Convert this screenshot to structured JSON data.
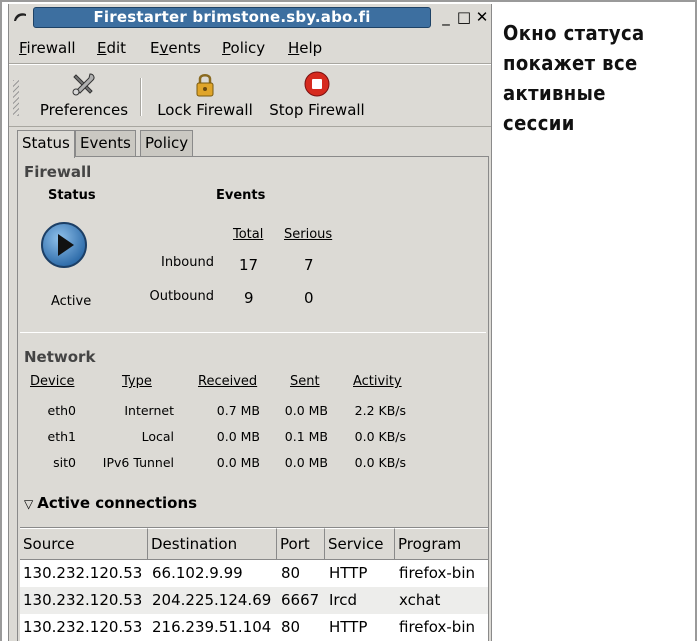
{
  "window": {
    "title": "Firestarter brimstone.sby.abo.fi",
    "controls": {
      "minimize": "_",
      "maximize": "□",
      "close": "✕"
    }
  },
  "menubar": {
    "items": [
      {
        "label": "Firewall",
        "mnemonic": "F",
        "rest": "irewall"
      },
      {
        "label": "Edit",
        "mnemonic": "E",
        "rest": "dit"
      },
      {
        "label": "Events",
        "mnemonic": "v",
        "pre": "E",
        "rest": "ents"
      },
      {
        "label": "Policy",
        "mnemonic": "P",
        "rest": "olicy"
      },
      {
        "label": "Help",
        "mnemonic": "H",
        "rest": "elp"
      }
    ]
  },
  "toolbar": {
    "preferences": {
      "label": "Preferences",
      "icon": "tools-icon"
    },
    "lock": {
      "label": "Lock Firewall",
      "icon": "padlock-icon"
    },
    "stop": {
      "label": "Stop Firewall",
      "icon": "stop-icon"
    }
  },
  "tabs": [
    {
      "label": "Status",
      "active": true
    },
    {
      "label": "Events",
      "active": false
    },
    {
      "label": "Policy",
      "active": false
    }
  ],
  "firewall": {
    "section_title": "Firewall",
    "status_header": "Status",
    "events_header": "Events",
    "total_header": "Total",
    "serious_header": "Serious",
    "status_text": "Active",
    "status_icon": "play-icon",
    "rows": [
      {
        "label": "Inbound",
        "total": "17",
        "serious": "7"
      },
      {
        "label": "Outbound",
        "total": "9",
        "serious": "0"
      }
    ]
  },
  "network": {
    "section_title": "Network",
    "headers": {
      "device": "Device",
      "type": "Type",
      "received": "Received",
      "sent": "Sent",
      "activity": "Activity"
    },
    "rows": [
      {
        "device": "eth0",
        "type": "Internet",
        "received": "0.7 MB",
        "sent": "0.0 MB",
        "activity": "2.2 KB/s"
      },
      {
        "device": "eth1",
        "type": "Local",
        "received": "0.0 MB",
        "sent": "0.1 MB",
        "activity": "0.0 KB/s"
      },
      {
        "device": "sit0",
        "type": "IPv6 Tunnel",
        "received": "0.0 MB",
        "sent": "0.0 MB",
        "activity": "0.0 KB/s"
      }
    ]
  },
  "connections": {
    "section_title": "Active connections",
    "expander": "▽",
    "headers": {
      "source": "Source",
      "destination": "Destination",
      "port": "Port",
      "service": "Service",
      "program": "Program"
    },
    "rows": [
      {
        "source": "130.232.120.53",
        "destination": "66.102.9.99",
        "port": "80",
        "service": "HTTP",
        "program": "firefox-bin"
      },
      {
        "source": "130.232.120.53",
        "destination": "204.225.124.69",
        "port": "6667",
        "service": "Ircd",
        "program": "xchat"
      },
      {
        "source": "130.232.120.53",
        "destination": "216.239.51.104",
        "port": "80",
        "service": "HTTP",
        "program": "firefox-bin"
      }
    ]
  },
  "caption": {
    "lines": [
      "Окно статуса",
      "покажет все",
      "активные",
      "сессии"
    ]
  },
  "colors": {
    "titlebar": "#3d6fa0",
    "window_bg": "#dcdad5",
    "stop_red": "#d62a1e",
    "play_blue": "#3b7fc2"
  }
}
